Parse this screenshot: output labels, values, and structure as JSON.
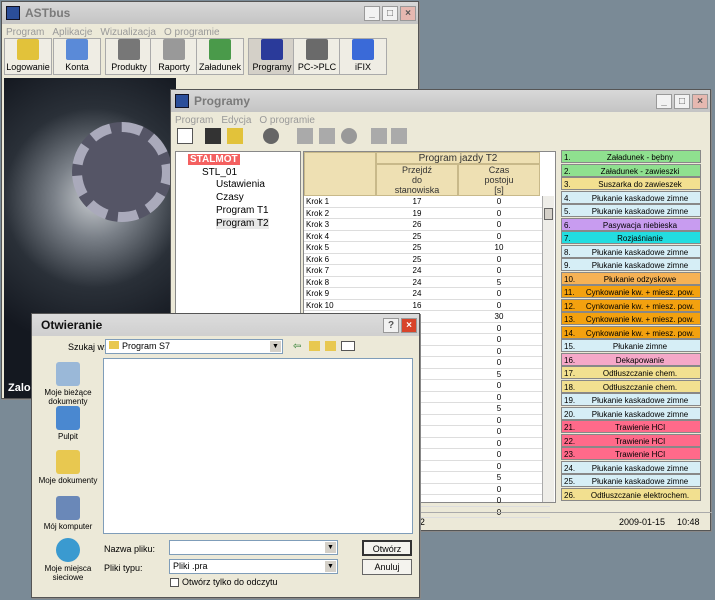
{
  "main": {
    "title": "ASTbus",
    "menu": [
      "Program",
      "Aplikacje",
      "Wizualizacja",
      "O programie"
    ],
    "buttons": [
      "Logowanie",
      "Konta",
      "Produkty",
      "Raporty",
      "Załadunek",
      "Programy",
      "PC->PLC",
      "iFIX"
    ],
    "status": "Zalog"
  },
  "programy": {
    "title": "Programy",
    "menu": [
      "Program",
      "Edycja",
      "O programie"
    ],
    "tree": {
      "root": "STALMOT",
      "node": "STL_01",
      "items": [
        "Ustawienia",
        "Czasy",
        "Program T1",
        "Program T2"
      ]
    },
    "table": {
      "title": "Program jazdy T2",
      "col_a": [
        "Przejdź",
        "do",
        "stanowiska"
      ],
      "col_b": [
        "Czas",
        "postoju",
        "[s]"
      ],
      "rows": [
        [
          "Krok 1",
          "17",
          "0"
        ],
        [
          "Krok 2",
          "19",
          "0"
        ],
        [
          "Krok 3",
          "26",
          "0"
        ],
        [
          "Krok 4",
          "25",
          "0"
        ],
        [
          "Krok 5",
          "25",
          "10"
        ],
        [
          "Krok 6",
          "25",
          "0"
        ],
        [
          "Krok 7",
          "24",
          "0"
        ],
        [
          "Krok 8",
          "24",
          "5"
        ],
        [
          "Krok 9",
          "24",
          "0"
        ],
        [
          "Krok 10",
          "16",
          "0"
        ]
      ],
      "extra_times": [
        "30",
        "0",
        "0",
        "0",
        "0",
        "5",
        "0",
        "0",
        "5",
        "0",
        "0",
        "0",
        "0",
        "0",
        "5",
        "0",
        "0",
        "0"
      ]
    },
    "stations": [
      {
        "n": "1.",
        "l": "Załadunek - bębny",
        "c": "#8fe08f"
      },
      {
        "n": "2.",
        "l": "Załadunek - zawieszki",
        "c": "#8fe08f"
      },
      {
        "n": "3.",
        "l": "Suszarka do zawieszek",
        "c": "#f2e090"
      },
      {
        "n": "4.",
        "l": "Płukanie kaskadowe zimne",
        "c": "#d6eef6"
      },
      {
        "n": "5.",
        "l": "Płukanie kaskadowe zimne",
        "c": "#d6eef6"
      },
      {
        "n": "6.",
        "l": "Pasywacja niebieska",
        "c": "#c89cf0"
      },
      {
        "n": "7.",
        "l": "Rozjaśnianie",
        "c": "#22dde0"
      },
      {
        "n": "8.",
        "l": "Płukanie kaskadowe zimne",
        "c": "#d6eef6"
      },
      {
        "n": "9.",
        "l": "Płukanie kaskadowe zimne",
        "c": "#d6eef6"
      },
      {
        "n": "10.",
        "l": "Płukanie odzyskowe",
        "c": "#f6b255"
      },
      {
        "n": "11.",
        "l": "Cynkowanie kw. + miesz. pow.",
        "c": "#f3a10f"
      },
      {
        "n": "12.",
        "l": "Cynkowanie kw. + miesz. pow.",
        "c": "#f3a10f"
      },
      {
        "n": "13.",
        "l": "Cynkowanie kw. + miesz. pow.",
        "c": "#f3a10f"
      },
      {
        "n": "14.",
        "l": "Cynkowanie kw. + miesz. pow.",
        "c": "#f3a10f"
      },
      {
        "n": "15.",
        "l": "Płukanie zimne",
        "c": "#d6eef6"
      },
      {
        "n": "16.",
        "l": "Dekapowanie",
        "c": "#f5a8c8"
      },
      {
        "n": "17.",
        "l": "Odtłuszczanie chem.",
        "c": "#f2e090"
      },
      {
        "n": "18.",
        "l": "Odtłuszczanie chem.",
        "c": "#f2e090"
      },
      {
        "n": "19.",
        "l": "Płukanie kaskadowe zimne",
        "c": "#d6eef6"
      },
      {
        "n": "20.",
        "l": "Płukanie kaskadowe zimne",
        "c": "#d6eef6"
      },
      {
        "n": "21.",
        "l": "Trawienie HCl",
        "c": "#ff6a8a"
      },
      {
        "n": "22.",
        "l": "Trawienie HCl",
        "c": "#ff6a8a"
      },
      {
        "n": "23.",
        "l": "Trawienie HCl",
        "c": "#ff6a8a"
      },
      {
        "n": "24.",
        "l": "Płukanie kaskadowe zimne",
        "c": "#d6eef6"
      },
      {
        "n": "25.",
        "l": "Płukanie kaskadowe zimne",
        "c": "#d6eef6"
      },
      {
        "n": "26.",
        "l": "Odtłuszczanie elektrochem.",
        "c": "#f2e090"
      }
    ],
    "statusbar": {
      "left": "n T2",
      "date": "2009-01-15",
      "time": "10:48"
    }
  },
  "dialog": {
    "title": "Otwieranie",
    "look_in_label": "Szukaj w:",
    "look_in": "Program S7",
    "places": [
      {
        "l1": "Moje bieżące",
        "l2": "dokumenty"
      },
      {
        "l1": "Pulpit",
        "l2": ""
      },
      {
        "l1": "Moje dokumenty",
        "l2": ""
      },
      {
        "l1": "Mój komputer",
        "l2": ""
      },
      {
        "l1": "Moje miejsca",
        "l2": "sieciowe"
      }
    ],
    "filename_label": "Nazwa pliku:",
    "filename": "",
    "filetype_label": "Pliki typu:",
    "filetype": "Pliki .pra",
    "readonly_label": "Otwórz tylko do odczytu",
    "open": "Otwórz",
    "cancel": "Anuluj"
  }
}
